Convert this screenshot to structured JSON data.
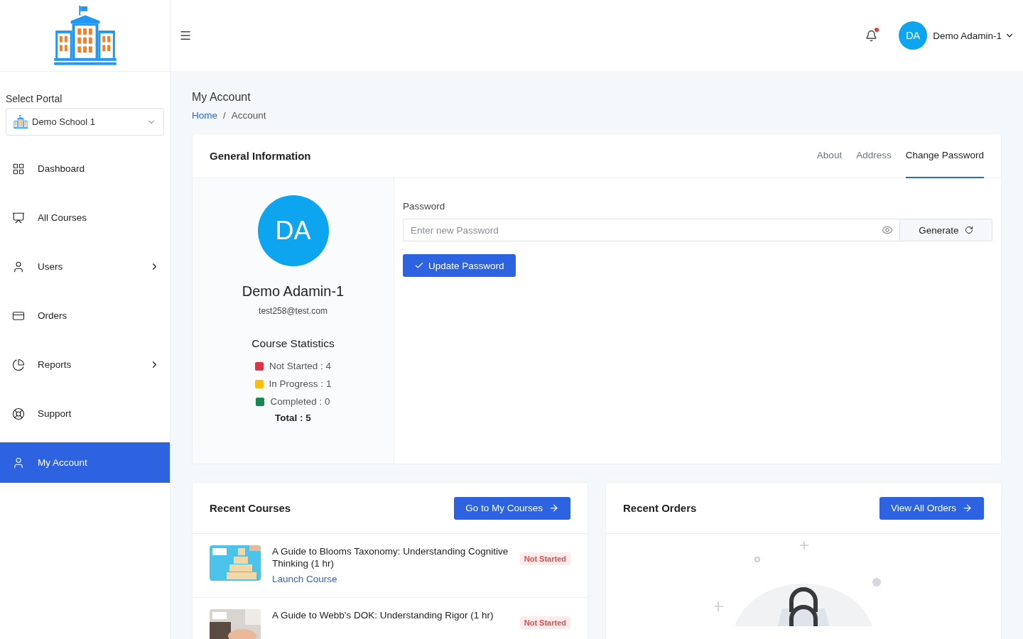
{
  "sidebar": {
    "portal_label": "Select Portal",
    "portal_value": "Demo School 1",
    "items": [
      {
        "label": "Dashboard",
        "submenu": false,
        "selected": false
      },
      {
        "label": "All Courses",
        "submenu": false,
        "selected": false
      },
      {
        "label": "Users",
        "submenu": true,
        "selected": false
      },
      {
        "label": "Orders",
        "submenu": false,
        "selected": false
      },
      {
        "label": "Reports",
        "submenu": true,
        "selected": false
      },
      {
        "label": "Support",
        "submenu": false,
        "selected": false
      },
      {
        "label": "My Account",
        "submenu": false,
        "selected": true
      }
    ]
  },
  "header": {
    "notification_unread": true,
    "avatar": "DA",
    "user_name": "Demo Adamin-1"
  },
  "page_title": "My Account",
  "breadcrumb_separator": "/",
  "breadcrumb": [
    {
      "label": "Home",
      "link": true
    },
    {
      "label": "Account",
      "link": false
    }
  ],
  "profile_card": {
    "title": "General Information",
    "tabs": [
      {
        "label": "About",
        "selected": false
      },
      {
        "label": "Address",
        "selected": false
      },
      {
        "label": "Change Password",
        "selected": true
      }
    ],
    "avatar": "DA",
    "name": "Demo Adamin-1",
    "email": "test258@test.com",
    "stats_title": "Course Statistics",
    "stats": [
      {
        "label": "Not Started : 4",
        "color": "#dc3545"
      },
      {
        "label": "In Progress : 1",
        "color": "#ffc107"
      },
      {
        "label": "Completed : 0",
        "color": "#198754"
      }
    ],
    "total": "Total : 5",
    "password_label": "Password",
    "password_placeholder": "Enter new Password",
    "generate_button": "Generate",
    "update_button": "Update Password"
  },
  "recent_courses": {
    "title": "Recent Courses",
    "button": "Go to My Courses",
    "courses": [
      {
        "title": "A Guide to Blooms Taxonomy: Understanding Cognitive Thinking (1 hr)",
        "status": "Not Started",
        "link": "Launch Course"
      },
      {
        "title": "A Guide to Webb's DOK: Understanding Rigor (1 hr)",
        "status": "Not Started"
      }
    ]
  },
  "recent_orders": {
    "title": "Recent Orders",
    "button": "View All Orders"
  }
}
